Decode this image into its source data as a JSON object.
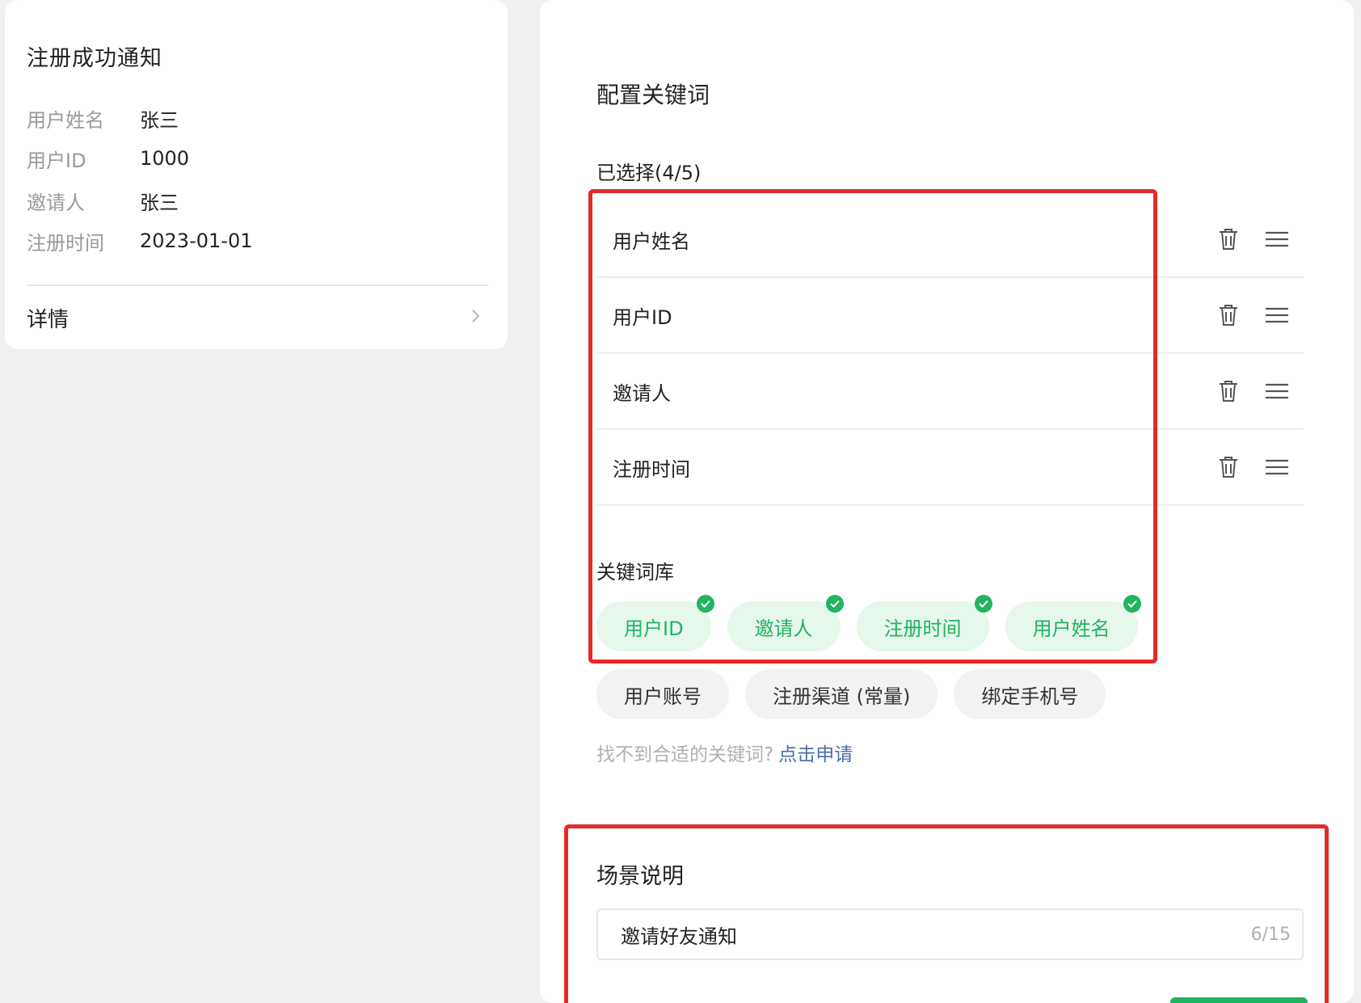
{
  "preview": {
    "title": "注册成功通知",
    "rows": [
      {
        "label": "用户姓名",
        "value": "张三"
      },
      {
        "label": "用户ID",
        "value": "1000"
      },
      {
        "label": "邀请人",
        "value": "张三"
      },
      {
        "label": "注册时间",
        "value": "2023-01-01"
      }
    ],
    "detail_label": "详情"
  },
  "config": {
    "title": "配置关键词",
    "selected_count": "已选择(4/5)",
    "selected": [
      {
        "label": "用户姓名"
      },
      {
        "label": "用户ID"
      },
      {
        "label": "邀请人"
      },
      {
        "label": "注册时间"
      }
    ],
    "library_title": "关键词库",
    "library_selected": [
      {
        "label": "用户ID"
      },
      {
        "label": "邀请人"
      },
      {
        "label": "注册时间"
      },
      {
        "label": "用户姓名"
      }
    ],
    "library_other": [
      {
        "label": "用户账号"
      },
      {
        "label": "注册渠道 (常量)"
      },
      {
        "label": "绑定手机号"
      }
    ],
    "hint_text": "找不到合适的关键词?",
    "hint_link": "点击申请"
  },
  "scene": {
    "title": "场景说明",
    "input_value": "邀请好友通知",
    "char_count": "6/15"
  },
  "colors": {
    "accent_green": "#21b361",
    "highlight_red": "#e42a2a",
    "link_blue": "#4a6ea8"
  },
  "icons": {
    "delete": "trash-icon",
    "drag": "drag-handle-icon",
    "check": "check-icon",
    "chevron": "chevron-right-icon"
  }
}
